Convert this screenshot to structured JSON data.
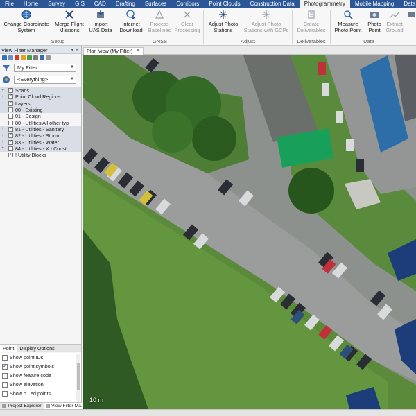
{
  "menu": {
    "tabs": [
      "File",
      "Home",
      "Survey",
      "GIS",
      "CAD",
      "Drafting",
      "Surfaces",
      "Corridors",
      "Point Clouds",
      "Construction Data",
      "Photogrammetry",
      "Mobile Mapping",
      "Data F"
    ],
    "active_tab": "Photogrammetry"
  },
  "ribbon": {
    "change_coord": "Change Coordinate System",
    "merge_flight": "Merge Flight Missions",
    "import_uas": "Import UAS Data",
    "internet_download": "Internet Download",
    "process_baselines": "Process Baselines",
    "clear_processing": "Clear Processing",
    "adjust_stations": "Adjust Photo Stations",
    "adjust_stations_gcps": "Adjust Photo Stations with GCPs",
    "create_deliverables": "Create Deliverables",
    "measure_point": "Measure Photo Point",
    "photo_point": "Photo Point",
    "extract_ground": "Extract Ground",
    "groups": {
      "setup": "Setup",
      "gnss": "GNSS",
      "adjust": "Adjust",
      "deliverables": "Deliverables",
      "data": "Data"
    }
  },
  "left_panel": {
    "title": "View Filter Manager",
    "filter_value": "My Filter",
    "everything_value": "<Everything>",
    "tree": [
      {
        "label": "Scans",
        "expander": "+",
        "checked": true,
        "shaded": true
      },
      {
        "label": "Point Cloud Regions",
        "expander": "+",
        "checked": true,
        "shaded": true
      },
      {
        "label": "Layers",
        "expander": "−",
        "checked": true,
        "shaded": true
      },
      {
        "label": "00 - Existing",
        "expander": "",
        "checked": false,
        "shaded": true
      },
      {
        "label": "01 - Design",
        "expander": "",
        "checked": false,
        "shaded": false
      },
      {
        "label": "80 - Utilities All other typ",
        "expander": "",
        "checked": false,
        "shaded": false
      },
      {
        "label": "81 - Utilities - Sanitary",
        "expander": "+",
        "checked": true,
        "shaded": true
      },
      {
        "label": "82 - Utilities - Storm",
        "expander": "+",
        "checked": true,
        "shaded": true
      },
      {
        "label": "83 - Utilities - Water",
        "expander": "+",
        "checked": true,
        "shaded": true
      },
      {
        "label": "84 - Utilities - X - Constr",
        "expander": "+",
        "checked": false,
        "shaded": true
      },
      {
        "label": "! Utility Blocks",
        "expander": "",
        "checked": true,
        "shaded": false
      }
    ],
    "tabs": [
      "Point",
      "Display Options"
    ],
    "options": [
      {
        "label": "Show point IDs",
        "checked": false
      },
      {
        "label": "Show point symbols",
        "checked": true
      },
      {
        "label": "Show feature code",
        "checked": false
      },
      {
        "label": "Show elevation",
        "checked": false
      },
      {
        "label": "Show d...ed points",
        "checked": false
      }
    ],
    "bottom_tabs": [
      "Project Explorer",
      "View Filter Ma..."
    ]
  },
  "document": {
    "tab_label": "Plan View (My Filter)",
    "close_glyph": "✕",
    "scale_label": "10 m"
  }
}
